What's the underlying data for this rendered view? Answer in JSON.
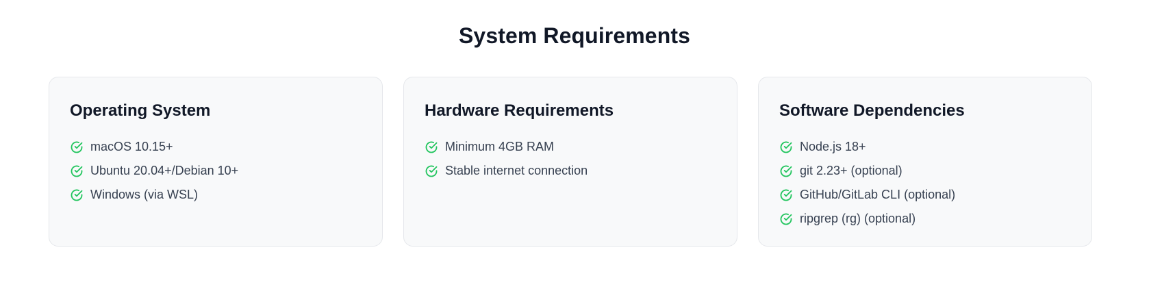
{
  "page": {
    "title": "System Requirements"
  },
  "cards": [
    {
      "title": "Operating System",
      "items": [
        "macOS 10.15+",
        "Ubuntu 20.04+/Debian 10+",
        "Windows (via WSL)"
      ]
    },
    {
      "title": "Hardware Requirements",
      "items": [
        "Minimum 4GB RAM",
        "Stable internet connection"
      ]
    },
    {
      "title": "Software Dependencies",
      "items": [
        "Node.js 18+",
        "git 2.23+ (optional)",
        "GitHub/GitLab CLI (optional)",
        "ripgrep (rg) (optional)"
      ]
    }
  ],
  "icons": {
    "item_icon": "check-circle-icon"
  },
  "colors": {
    "accent_green": "#22c55e",
    "card_background": "#f8f9fa",
    "card_border": "#e5e7eb",
    "heading": "#111827",
    "body_text": "#374151"
  }
}
